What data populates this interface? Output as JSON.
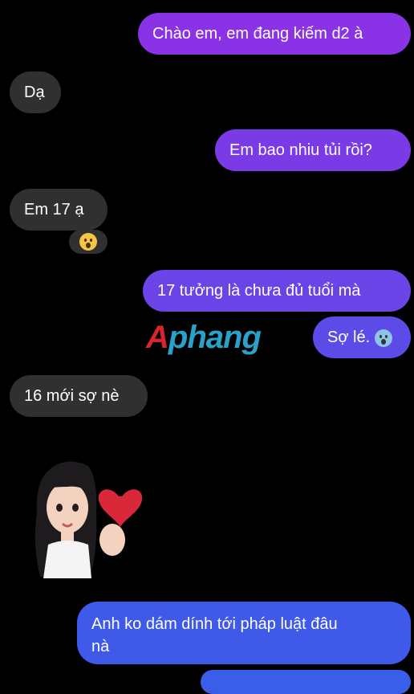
{
  "colors": {
    "background": "#000000",
    "received_bubble": "#303030",
    "sent_gradient_top": "#8b34e6",
    "sent_gradient_bottom": "#3a5ee8"
  },
  "watermark": {
    "first_letter": "A",
    "rest": "phang"
  },
  "messages": [
    {
      "side": "sent",
      "text": "Chào em, em đang kiếm d2 à"
    },
    {
      "side": "received",
      "text": "Dạ"
    },
    {
      "side": "sent",
      "text": "Em bao nhiu tủi rồi?"
    },
    {
      "side": "received",
      "text": "Em 17 ạ",
      "reaction": "astonished-emoji"
    },
    {
      "side": "sent",
      "text": "17 tưởng là chưa đủ tuổi mà"
    },
    {
      "side": "sent",
      "text": "Sợ lé.",
      "emoji": "screaming-face-emoji"
    },
    {
      "side": "received",
      "text": "16 mới sợ nè"
    },
    {
      "side": "received",
      "sticker": "girl-finger-heart-sticker"
    },
    {
      "side": "sent",
      "text_line1": "Anh ko dám dính tới pháp luật đâu",
      "text_line2": "nà"
    }
  ]
}
